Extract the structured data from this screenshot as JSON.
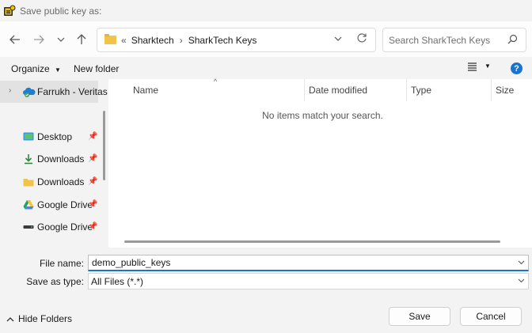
{
  "window": {
    "title": "Save public key as:"
  },
  "nav": {
    "back_icon": "arrow-left-icon",
    "forward_icon": "arrow-right-icon",
    "recent_icon": "chevron-down-icon",
    "up_icon": "arrow-up-icon"
  },
  "address": {
    "overflow": "«",
    "crumbs": [
      "Sharktech",
      "SharkTech Keys"
    ],
    "separator": "›"
  },
  "search": {
    "placeholder": "Search SharkTech Keys"
  },
  "toolbar": {
    "organize": "Organize",
    "new_folder": "New folder",
    "help": "?"
  },
  "sidebar": {
    "items": [
      {
        "label": "Farrukh - Veritas",
        "icon": "onedrive-cloud-icon",
        "pinned": false
      },
      {
        "label": "Desktop",
        "icon": "desktop-icon",
        "pinned": true
      },
      {
        "label": "Downloads",
        "icon": "downloads-icon",
        "pinned": true
      },
      {
        "label": "Downloads",
        "icon": "folder-icon",
        "pinned": true
      },
      {
        "label": "Google Drive",
        "icon": "google-drive-icon",
        "pinned": true
      },
      {
        "label": "Google Drive",
        "icon": "drive-icon",
        "pinned": true
      }
    ]
  },
  "files": {
    "columns": [
      "Name",
      "Date modified",
      "Type",
      "Size"
    ],
    "empty_message": "No items match your search."
  },
  "form": {
    "file_name_label": "File name:",
    "file_name_value": "demo_public_keys",
    "type_label": "Save as type:",
    "type_value": "All Files (*.*)"
  },
  "footer": {
    "hide_folders": "Hide Folders",
    "save": "Save",
    "cancel": "Cancel"
  },
  "colors": {
    "accent": "#1a73d1",
    "folder": "#f0c44a"
  }
}
